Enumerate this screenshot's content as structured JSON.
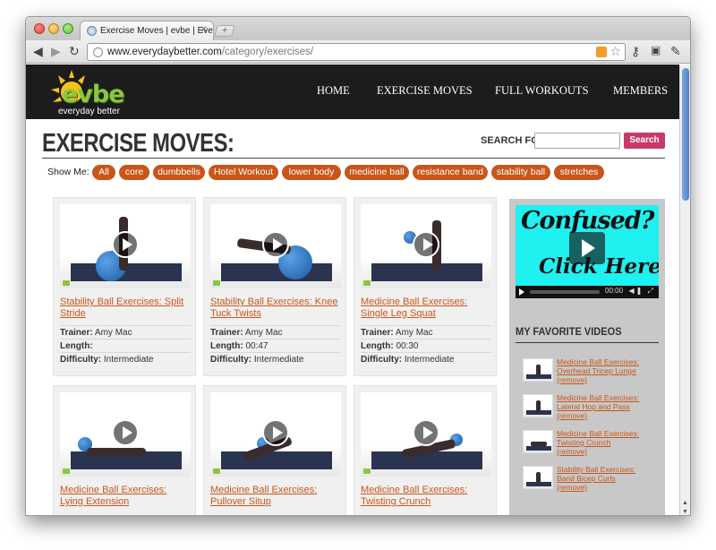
{
  "browser": {
    "tab_title": "Exercise Moves | evbe | Ever",
    "tab_close": "✕",
    "new_tab": "+",
    "url_domain": "www.everydaybetter.com",
    "url_path": "/category/exercises/"
  },
  "site": {
    "logo_text": "evbe",
    "logo_subtitle": "everyday better",
    "nav": [
      "HOME",
      "EXERCISE MOVES",
      "FULL WORKOUTS",
      "MEMBERS"
    ]
  },
  "page": {
    "title": "EXERCISE MOVES:",
    "search_label": "SEARCH FOR:",
    "search_value": "",
    "search_button": "Search",
    "show_me": "Show Me:",
    "filters": [
      "All",
      "core",
      "dumbbells",
      "Hotel Workout",
      "lower body",
      "medicine ball",
      "resistance band",
      "stability ball",
      "stretches"
    ]
  },
  "labels": {
    "trainer": "Trainer:",
    "length": "Length:",
    "difficulty": "Difficulty:"
  },
  "cards": [
    {
      "title": "Stability Ball Exercises: Split Stride",
      "trainer": "Amy Mac",
      "length": "",
      "difficulty": "Intermediate"
    },
    {
      "title": "Stability Ball Exercises: Knee Tuck Twists",
      "trainer": "Amy Mac",
      "length": "00:47",
      "difficulty": "Intermediate"
    },
    {
      "title": "Medicine Ball Exercises: Single Leg Squat",
      "trainer": "Amy Mac",
      "length": "00:30",
      "difficulty": "Intermediate"
    },
    {
      "title": "Medicine Ball Exercises: Lying Extension"
    },
    {
      "title": "Medicine Ball Exercises: Pullover Situp"
    },
    {
      "title": "Medicine Ball Exercises: Twisting Crunch"
    }
  ],
  "sidebar": {
    "video_line1": "Confused?",
    "video_line2": "Click Here",
    "video_time": "00:00",
    "favorites_title": "MY FAVORITE VIDEOS",
    "remove_label": "(remove)",
    "favorites": [
      "Medicine Ball Exercises: Overhead Tricep Lunge",
      "Medicine Ball Exercises: Lateral Hop and Pass",
      "Medicine Ball Exercises: Twisting Crunch",
      "Stability Ball Exercises: Band Bicep Curls"
    ]
  },
  "colors": {
    "accent_orange": "#c8561a",
    "search_button": "#c73a6a",
    "header_bg": "#1c1c1c",
    "logo_green": "#8cc63f"
  }
}
